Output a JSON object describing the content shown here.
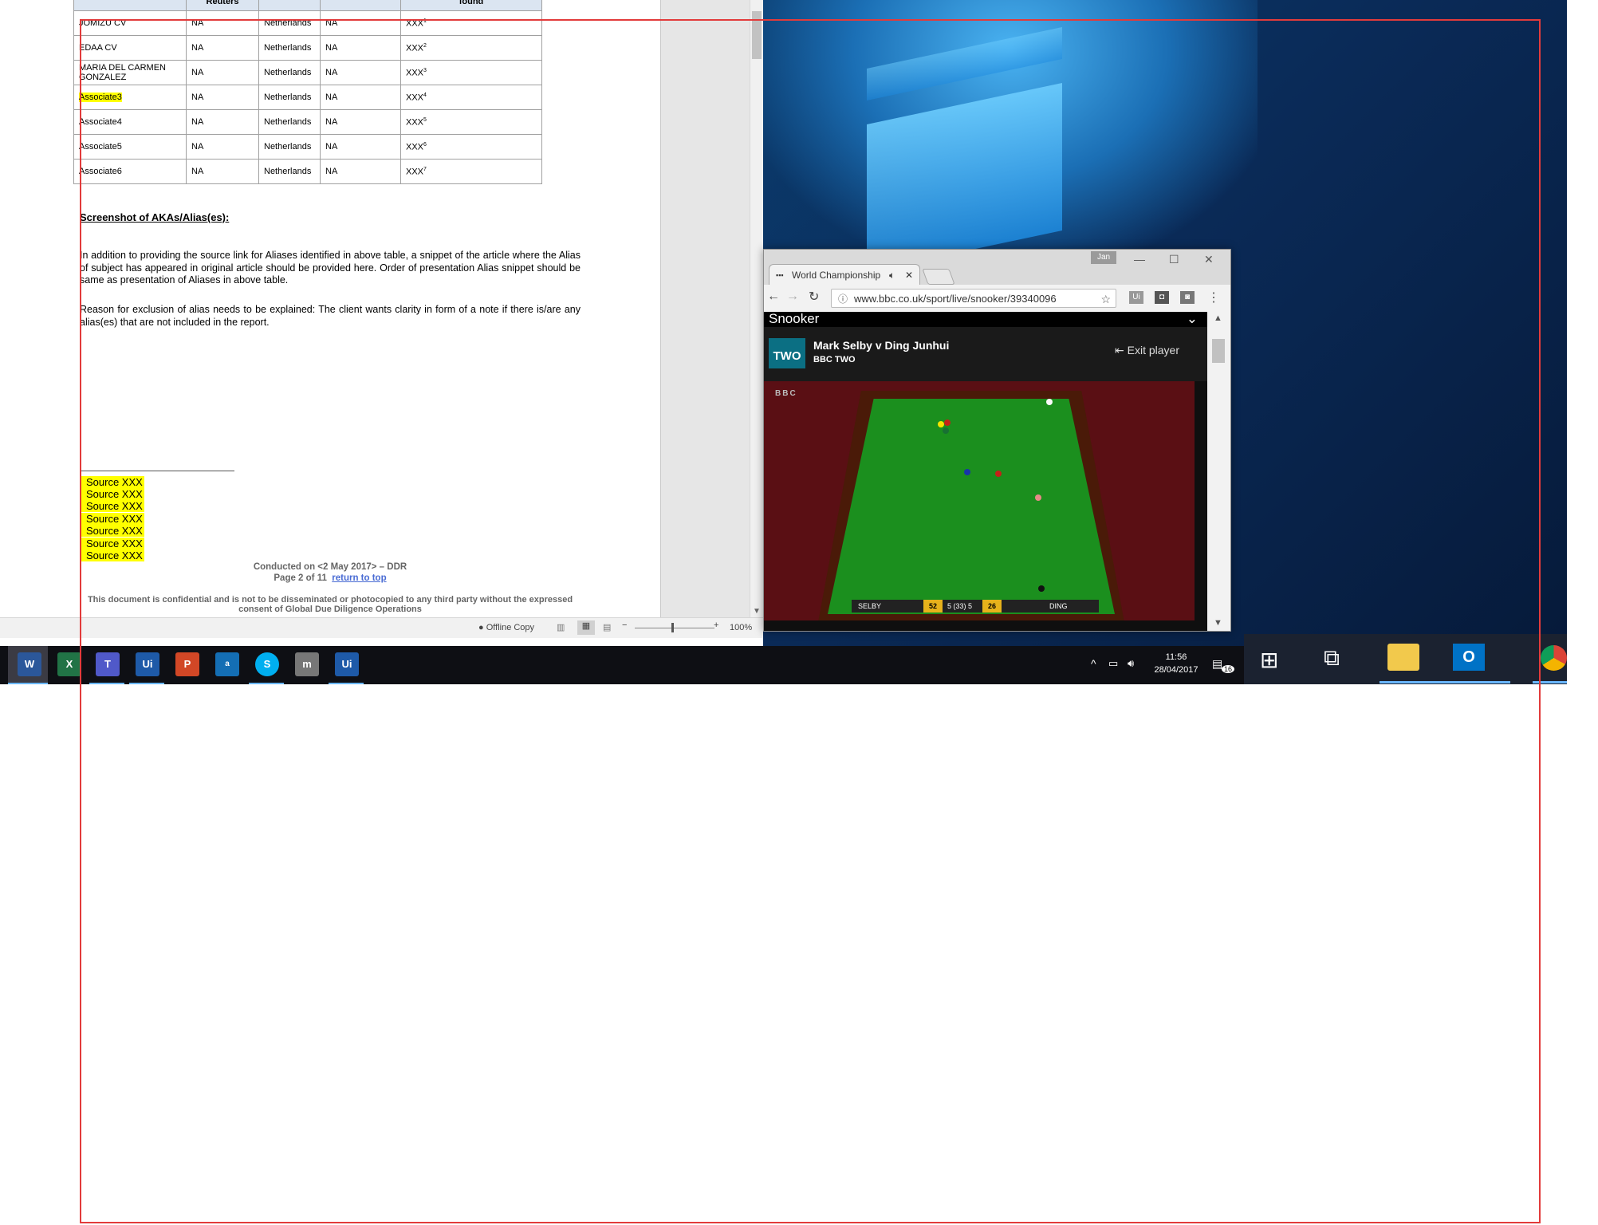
{
  "word": {
    "table": {
      "header_partial": [
        "Reuters",
        "found"
      ],
      "rows": [
        {
          "name": "JOMIZU CV",
          "c2": "NA",
          "c3": "Netherlands",
          "c4": "NA",
          "c5": "XXX",
          "sup": "1"
        },
        {
          "name": "EDAA CV",
          "c2": "NA",
          "c3": "Netherlands",
          "c4": "NA",
          "c5": "XXX",
          "sup": "2"
        },
        {
          "name": "MARIA DEL CARMEN GONZALEZ",
          "c2": "NA",
          "c3": "Netherlands",
          "c4": "NA",
          "c5": "XXX",
          "sup": "3"
        },
        {
          "name": "Associate3",
          "c2": "NA",
          "c3": "Netherlands",
          "c4": "NA",
          "c5": "XXX",
          "sup": "4"
        },
        {
          "name": "Associate4",
          "c2": "NA",
          "c3": "Netherlands",
          "c4": "NA",
          "c5": "XXX",
          "sup": "5"
        },
        {
          "name": "Associate5",
          "c2": "NA",
          "c3": "Netherlands",
          "c4": "NA",
          "c5": "XXX",
          "sup": "6"
        },
        {
          "name": "Associate6",
          "c2": "NA",
          "c3": "Netherlands",
          "c4": "NA",
          "c5": "XXX",
          "sup": "7"
        }
      ]
    },
    "heading": "Screenshot of AKAs/Alias(es):",
    "para1": "In addition to providing the source link for Aliases identified in above table, a snippet of the article where the Alias of subject has appeared in original article should be provided here. Order of presentation Alias snippet should be same as presentation of Aliases in above table.",
    "para2": "Reason for exclusion of alias needs to be explained: The client wants clarity in form of a note if there is/are any alias(es) that are not included in the report.",
    "footnotes": [
      "Source XXX",
      "Source XXX",
      "Source XXX",
      "Source XXX",
      "Source XXX",
      "Source XXX",
      "Source XXX"
    ],
    "footer_line1": "Conducted on <2 May 2017> – DDR",
    "footer_page": "Page 2 of 11",
    "footer_link": "return to top",
    "footer_conf": "This document is confidential and is not to be disseminated or photocopied to any third party without the expressed consent of Global Due Diligence Operations",
    "status_offline": "Offline Copy",
    "zoom": "100%"
  },
  "chrome": {
    "user": "Jan",
    "tab_title": "World Championship",
    "url": "www.bbc.co.uk/sport/live/snooker/39340096",
    "section": "Snooker",
    "channel_logo": "TWO",
    "match_title": "Mark Selby v Ding Junhui",
    "channel": "BBC TWO",
    "exit_player": "Exit player",
    "video_logo": "BBC",
    "score": {
      "p1": "SELBY",
      "s1": "52",
      "frames": "5 (33) 5",
      "s2": "26",
      "p2": "DING"
    }
  },
  "taskbar": {
    "apps": [
      "W",
      "X",
      "T",
      "Ui",
      "P",
      "a",
      "S",
      "m",
      "Ui"
    ],
    "time": "11:56",
    "date": "28/04/2017",
    "notifications": "16"
  },
  "colors": {
    "highlight": "#ffff00",
    "overlay_box": "#e23b3b",
    "taskbar": "#0e0f14",
    "desktop": "#0a2a57"
  }
}
